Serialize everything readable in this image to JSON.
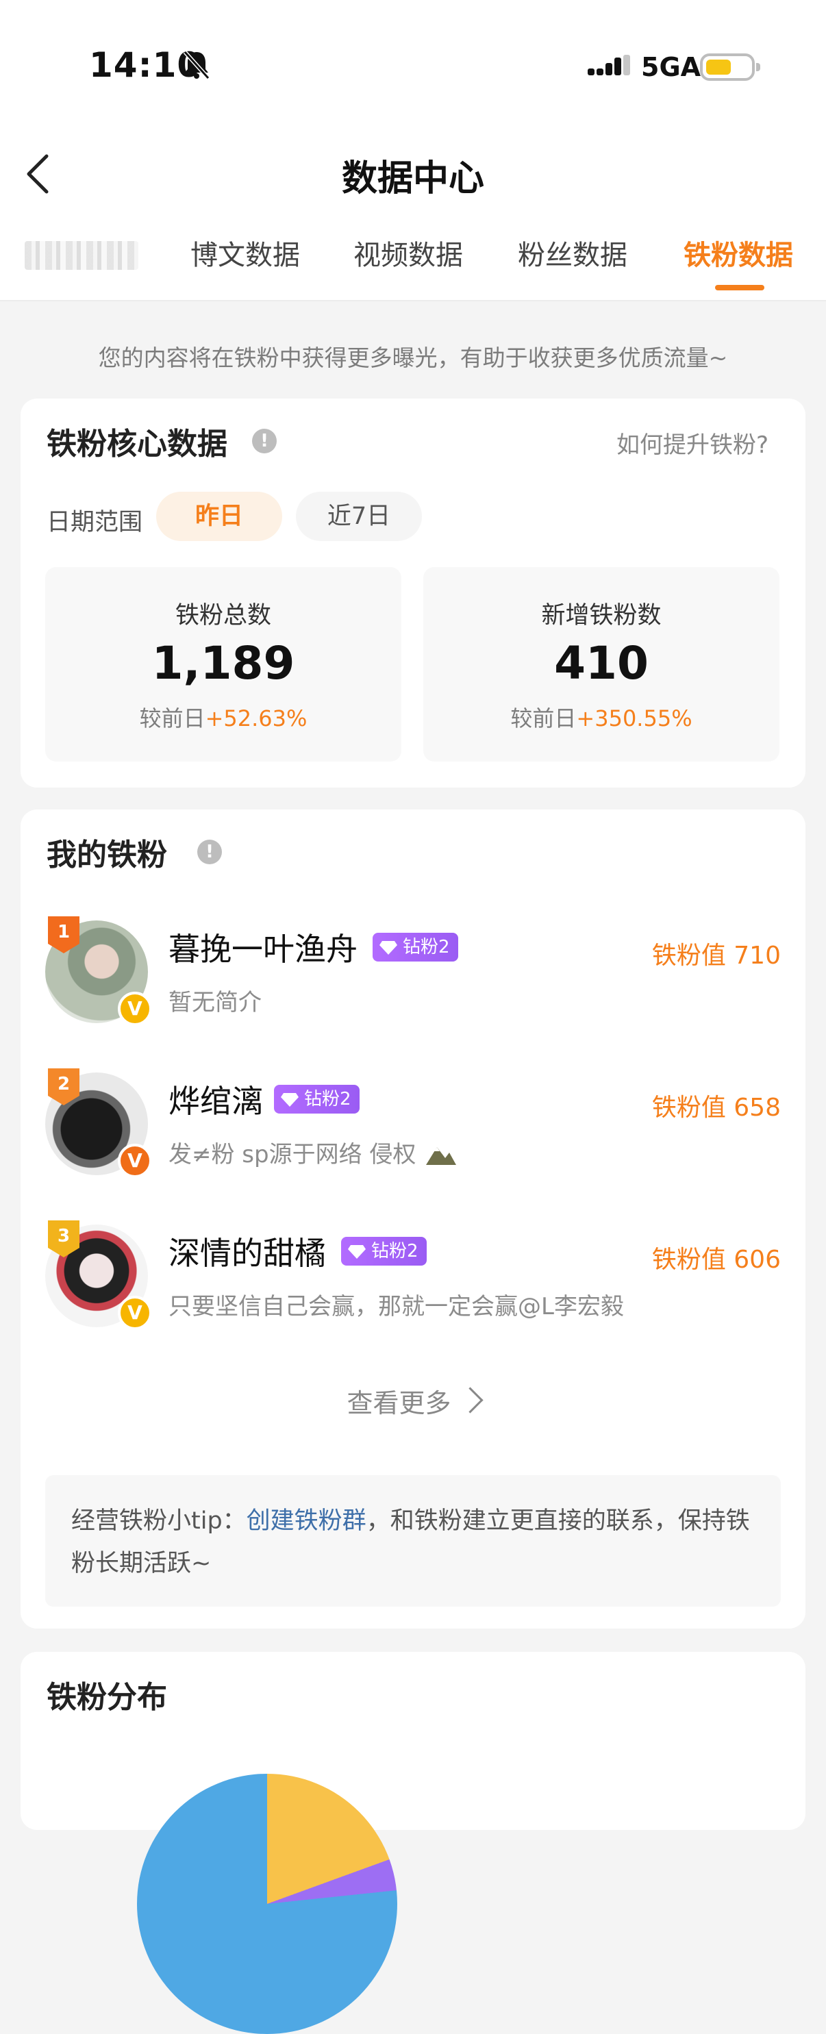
{
  "status_bar": {
    "time": "14:10",
    "network": "5GA",
    "colors": {
      "battery": "#f6c514"
    }
  },
  "header": {
    "title": "数据中心",
    "tabs": [
      {
        "label": "博文数据",
        "active": false
      },
      {
        "label": "视频数据",
        "active": false
      },
      {
        "label": "粉丝数据",
        "active": false
      },
      {
        "label": "铁粉数据",
        "active": true
      }
    ]
  },
  "notice": "您的内容将在铁粉中获得更多曝光，有助于收获更多优质流量~",
  "core": {
    "title": "铁粉核心数据",
    "info_icon": "!",
    "how_link": "如何提升铁粉?",
    "date_label": "日期范围",
    "date_options": [
      "昨日",
      "近7日"
    ],
    "selected_date": "昨日",
    "stats": [
      {
        "label": "铁粉总数",
        "value": "1,189",
        "change_prefix": "较前日",
        "change": "+52.63%"
      },
      {
        "label": "新增铁粉数",
        "value": "410",
        "change_prefix": "较前日",
        "change": "+350.55%"
      }
    ]
  },
  "my_fans": {
    "title": "我的铁粉",
    "info_icon": "!",
    "fans": [
      {
        "rank": "1",
        "name": "暮挽一叶渔舟",
        "level": "钻粉2",
        "bio": "暂无简介",
        "score": "铁粉值 710",
        "verified": "V"
      },
      {
        "rank": "2",
        "name": "烨绾漓",
        "level": "钻粉2",
        "bio": "发≠粉 sp源于网络 侵权",
        "score": "铁粉值 658",
        "verified": "V"
      },
      {
        "rank": "3",
        "name": "深情的甜橘",
        "level": "钻粉2",
        "bio": "只要坚信自己会赢，那就一定会赢@L李宏毅",
        "score": "铁粉值 606",
        "verified": "V"
      }
    ],
    "see_more": "查看更多",
    "tip_prefix": "经营铁粉小tip：",
    "tip_link": "创建铁粉群",
    "tip_suffix": "，和铁粉建立更直接的联系，保持铁粉长期活跃~"
  },
  "distribution": {
    "title": "铁粉分布"
  },
  "colors": {
    "accent": "#f57f1b",
    "link": "#3e6fa9",
    "level_badge": "#a463f7"
  }
}
